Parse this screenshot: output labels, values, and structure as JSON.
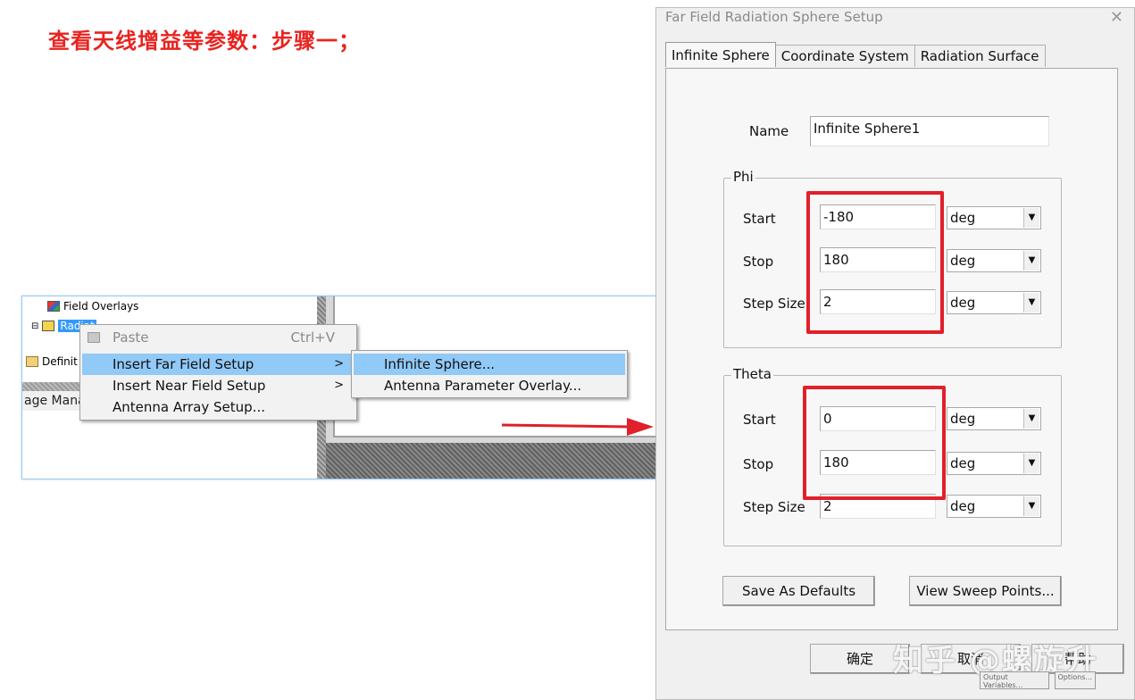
{
  "heading": "查看天线增益等参数：步骤一；",
  "tree": {
    "field_overlays": "Field Overlays",
    "radiation": "Radiat",
    "definitions": "Definit",
    "package_manager": "age Mana"
  },
  "context_menu": {
    "paste": "Paste",
    "paste_shortcut": "Ctrl+V",
    "insert_far_field": "Insert Far Field Setup",
    "insert_near_field": "Insert Near Field Setup",
    "antenna_array": "Antenna Array Setup..."
  },
  "submenu": {
    "infinite_sphere": "Infinite Sphere...",
    "antenna_parameter_overlay": "Antenna Parameter Overlay..."
  },
  "dialog": {
    "title": "Far Field Radiation Sphere Setup",
    "tabs": [
      "Infinite Sphere",
      "Coordinate System",
      "Radiation Surface"
    ],
    "name_label": "Name",
    "name_value": "Infinite Sphere1",
    "phi": {
      "title": "Phi",
      "start_label": "Start",
      "start": "-180",
      "start_unit": "deg",
      "stop_label": "Stop",
      "stop": "180",
      "stop_unit": "deg",
      "step_label": "Step Size",
      "step": "2",
      "step_unit": "deg"
    },
    "theta": {
      "title": "Theta",
      "start_label": "Start",
      "start": "0",
      "start_unit": "deg",
      "stop_label": "Stop",
      "stop": "180",
      "stop_unit": "deg",
      "step_label": "Step Size",
      "step": "2",
      "step_unit": "deg"
    },
    "save_defaults": "Save As Defaults",
    "view_sweep": "View Sweep Points...",
    "ok": "确定",
    "cancel": "取消",
    "help": "帮助"
  },
  "watermark": "知乎 @螺旋升",
  "bottom_fragments": [
    "Output Variables...",
    "Options..."
  ],
  "colors": {
    "highlight": "#e0202a",
    "menu_highlight": "#91c9f7",
    "heading": "#e8231f"
  }
}
